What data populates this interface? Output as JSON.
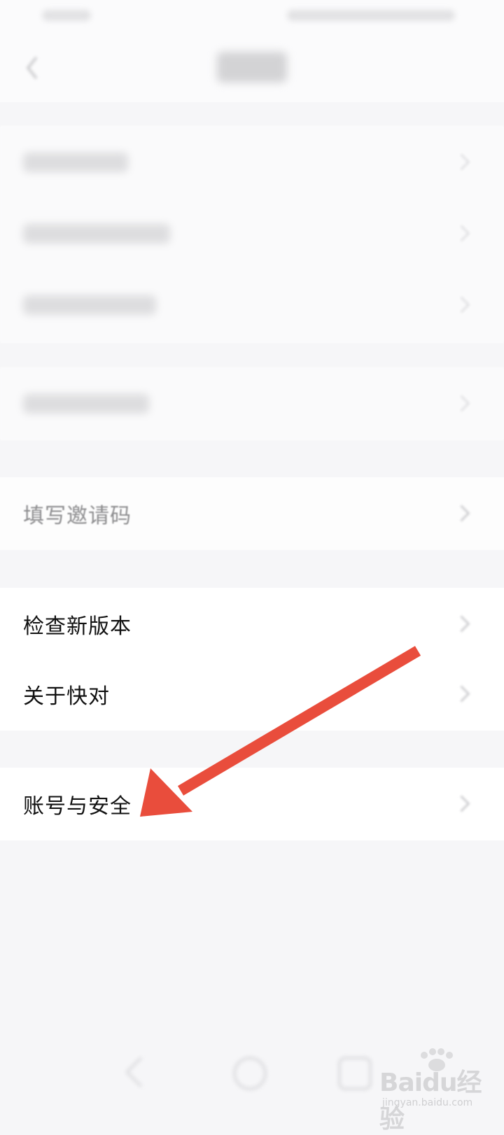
{
  "settings": {
    "group3": {
      "invite_code_label": "填写邀请码"
    },
    "group4": {
      "check_version_label": "检查新版本",
      "about_label": "关于快对"
    },
    "group5": {
      "account_security_label": "账号与安全"
    }
  },
  "watermark": {
    "logo_text": "Baidu经验",
    "url_text": "jingyan.baidu.com"
  },
  "colors": {
    "annotation_arrow": "#e94d3c",
    "background": "#f6f6f8",
    "row_background": "#ffffff"
  },
  "icons": [
    "back-icon",
    "chevron-right-icon",
    "nav-back-icon",
    "nav-home-icon",
    "nav-recents-icon",
    "baidu-paw-icon"
  ]
}
